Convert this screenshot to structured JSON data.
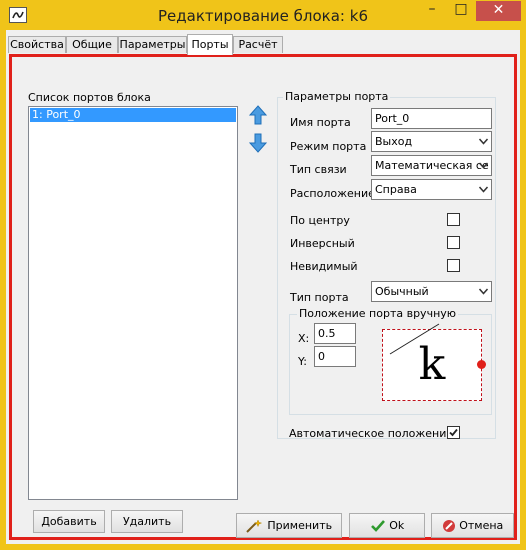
{
  "window": {
    "title": "Редактирование блока: k6",
    "minimize": "–",
    "maximize": "□",
    "close": "✕"
  },
  "tabs": [
    {
      "label": "Свойства"
    },
    {
      "label": "Общие"
    },
    {
      "label": "Параметры"
    },
    {
      "label": "Порты"
    },
    {
      "label": "Расчёт"
    }
  ],
  "ports_list": {
    "title": "Список портов блока",
    "items": [
      "1: Port_0"
    ]
  },
  "params": {
    "title": "Параметры порта",
    "port_name_label": "Имя порта",
    "port_name_value": "Port_0",
    "port_mode_label": "Режим порта",
    "port_mode_value": "Выход",
    "link_type_label": "Тип связи",
    "link_type_value": "Математическая се",
    "location_label": "Расположение",
    "location_value": "Справа",
    "center_label": "По центру",
    "inverse_label": "Инверсный",
    "invisible_label": "Невидимый",
    "port_type_label": "Тип порта",
    "port_type_value": "Обычный",
    "center_checked": false,
    "inverse_checked": false,
    "invisible_checked": false
  },
  "manual": {
    "title": "Положение порта вручную",
    "x_label": "X:",
    "x_value": "0.5",
    "y_label": "Y:",
    "y_value": "0",
    "preview_letter": "k"
  },
  "auto_position": {
    "label": "Автоматическое положение",
    "checked": true
  },
  "buttons": {
    "add": "Добавить",
    "delete": "Удалить",
    "apply": "Применить",
    "ok": "Ok",
    "cancel": "Отмена"
  },
  "colors": {
    "title_bar": "#f0c419",
    "selection": "#3399ff",
    "highlight_border": "#e0201a",
    "port_dot": "#e0201a"
  }
}
